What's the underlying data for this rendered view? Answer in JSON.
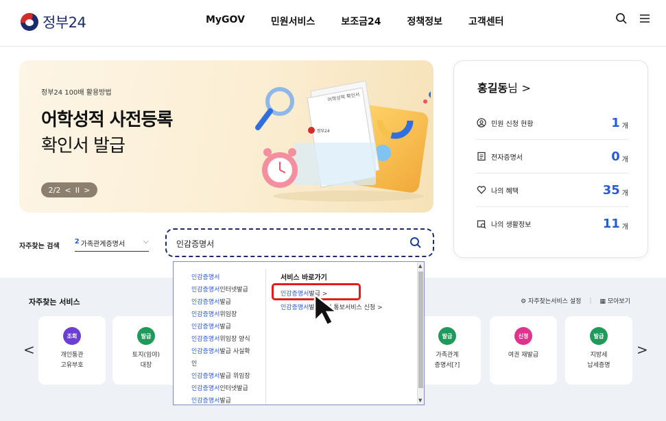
{
  "header": {
    "logo_text": "정부24",
    "nav": [
      "MyGOV",
      "민원서비스",
      "보조금24",
      "정책정보",
      "고객센터"
    ],
    "search_icon": "search-icon",
    "menu_icon": "hamburger-menu-icon"
  },
  "banner": {
    "subtitle": "정부24 100배 활용방법",
    "title_line1": "어학성적 사전등록",
    "title_line2": "확인서 발급",
    "pager_text": "2/2",
    "pager_prev": "<",
    "pager_pause": "II",
    "pager_next": ">",
    "doc_label": "어학성적 확인서",
    "doc_brand": "정부24"
  },
  "mygov": {
    "user_name": "홍길동",
    "user_suffix": "님",
    "user_chevron": ">",
    "rows": [
      {
        "icon": "application-status-icon",
        "label": "민원 신청 현황",
        "count": "1",
        "unit": "개"
      },
      {
        "icon": "document-icon",
        "label": "전자증명서",
        "count": "0",
        "unit": "개"
      },
      {
        "icon": "heart-icon",
        "label": "나의 혜택",
        "count": "35",
        "unit": "개"
      },
      {
        "icon": "life-info-icon",
        "label": "나의 생활정보",
        "count": "11",
        "unit": "개"
      }
    ]
  },
  "frequent_search": {
    "label": "자주찾는 검색",
    "selected_number": "2",
    "selected_text": "가족관계증명서",
    "chevron": "⌵"
  },
  "search": {
    "value": "인감증명서"
  },
  "dropdown": {
    "suggestions": [
      {
        "blue": "인감증명서",
        "black": ""
      },
      {
        "blue": "인감증명서",
        "black": "인터넷발급"
      },
      {
        "blue": "인감증명서",
        "black": "발급"
      },
      {
        "blue": "인감증명서",
        "black": "위임장"
      },
      {
        "blue": "인감증명서",
        "black": "발급"
      },
      {
        "blue": "인감증명서",
        "black": "위임장 양식"
      },
      {
        "blue": "인감증명서",
        "black": "발급 사실확"
      },
      {
        "blue": "",
        "black": "인"
      },
      {
        "blue": "인감증명서",
        "black": "발급 위임장"
      },
      {
        "blue": "인감증명서",
        "black": "인터넷발급"
      },
      {
        "blue": "인감증명서",
        "black": "발급"
      }
    ],
    "shortcut_heading": "서비스 바로가기",
    "shortcuts": [
      {
        "blue": "인감증명서",
        "black": "발급 >"
      },
      {
        "blue": "인감증명서",
        "black": "발급사실 통보서비스 신청 >"
      }
    ]
  },
  "services": {
    "title": "자주찾는 서비스",
    "setting_label": "자주찾는서비스 설정",
    "view_all_label": "모아보기",
    "prev_arrow": "<",
    "next_arrow": ">",
    "cards": [
      {
        "badge": "조회",
        "color": "#6b3fd4",
        "line1": "개인통관",
        "line2": "고유부호"
      },
      {
        "badge": "발급",
        "color": "#1f9a5a",
        "line1": "토지(임야)",
        "line2": "대장"
      },
      {
        "badge": "발급",
        "color": "#1f9a5a",
        "line1": "가족관계",
        "line2": "증명서[?]"
      },
      {
        "badge": "신청",
        "color": "#e0338c",
        "line1": "여권 재발급",
        "line2": ""
      },
      {
        "badge": "발급",
        "color": "#1f9a5a",
        "line1": "지방세",
        "line2": "납세증명"
      }
    ]
  }
}
